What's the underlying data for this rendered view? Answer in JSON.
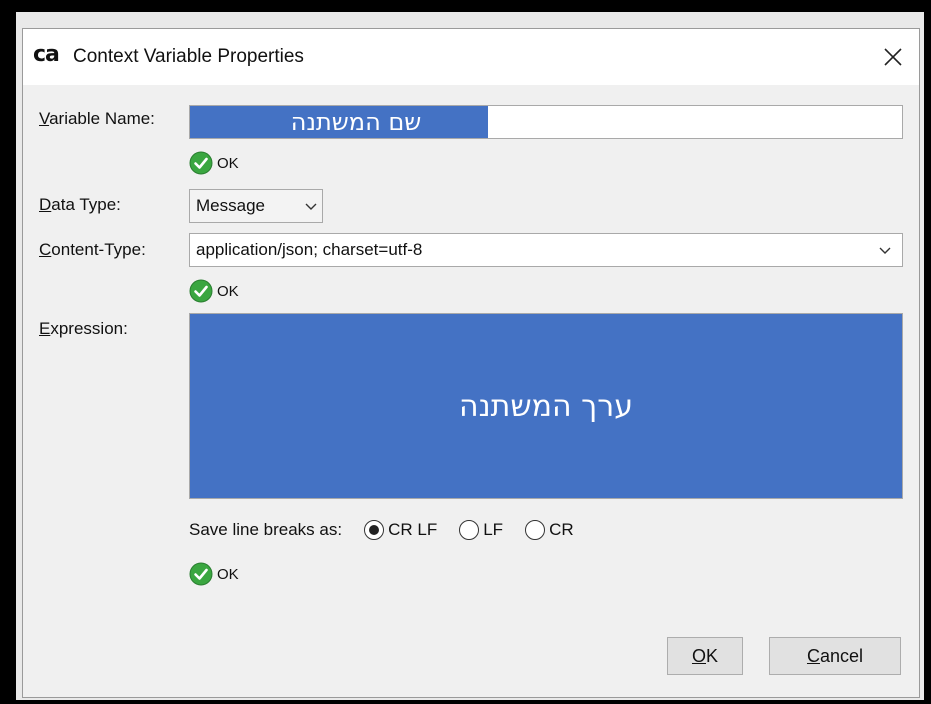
{
  "window": {
    "logo_text": "ca",
    "title": "Context Variable Properties",
    "close_glyph": "✕"
  },
  "variable_name": {
    "label_accel": "V",
    "label_rest": "ariable Name:",
    "value": "שם המשתנה",
    "status": "OK"
  },
  "data_type": {
    "label_accel": "D",
    "label_rest": "ata Type:",
    "selected": "Message"
  },
  "content_type": {
    "label_accel": "C",
    "label_rest": "ontent-Type:",
    "value": "application/json; charset=utf-8",
    "status": "OK"
  },
  "expression": {
    "label_accel": "E",
    "label_rest": "xpression:",
    "value": "ערך המשתנה",
    "status": "OK"
  },
  "line_breaks": {
    "label": "Save line breaks as:",
    "options": [
      {
        "label": "CR LF",
        "selected": true
      },
      {
        "label": "LF",
        "selected": false
      },
      {
        "label": "CR",
        "selected": false
      }
    ]
  },
  "buttons": {
    "ok_accel": "O",
    "ok_rest": "K",
    "cancel_accel": "C",
    "cancel_rest": "ancel"
  },
  "colors": {
    "highlight": "#4472c4",
    "check_green": "#3aa640"
  },
  "icons": {
    "status": "check-circle-icon",
    "dropdown": "chevron-down-icon",
    "close": "close-icon"
  }
}
